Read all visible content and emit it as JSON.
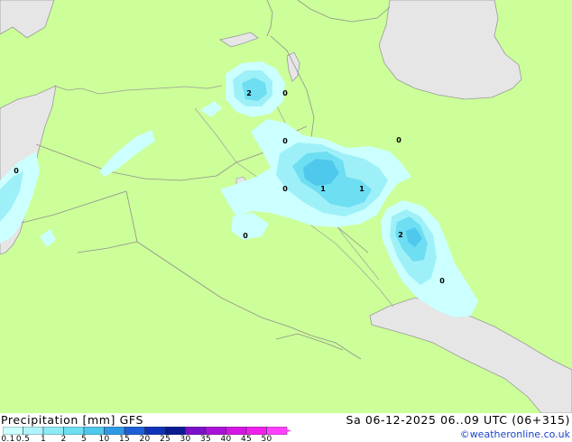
{
  "map": {
    "contour_labels": [
      {
        "text": "2"
      },
      {
        "text": "0"
      },
      {
        "text": "0"
      },
      {
        "text": "0"
      },
      {
        "text": "0"
      },
      {
        "text": "1"
      },
      {
        "text": "1"
      },
      {
        "text": "0"
      },
      {
        "text": "2"
      },
      {
        "text": "0"
      },
      {
        "text": "0"
      }
    ],
    "colors": {
      "land": "#ccff99",
      "sea": "#e6e6e6",
      "borders": "#8f8f8f",
      "coast": "#9a9a9a"
    }
  },
  "footer": {
    "product_title": "Precipitation [mm] GFS",
    "valid_time": "Sa 06-12-2025 06..09 UTC (06+315)",
    "credit": "©weatheronline.co.uk",
    "legend": {
      "ticks": [
        "0.1",
        "0.5",
        "1",
        "2",
        "5",
        "10",
        "15",
        "20",
        "25",
        "30",
        "35",
        "40",
        "45",
        "50"
      ],
      "colors": [
        "#ccffff",
        "#aef4fb",
        "#8eeaf7",
        "#6edef2",
        "#4ec8ec",
        "#2e9ae4",
        "#1e5ed6",
        "#1032b8",
        "#0a1a90",
        "#7a10c8",
        "#a812d8",
        "#d218e2",
        "#f020ec",
        "#ff40ff"
      ]
    }
  }
}
